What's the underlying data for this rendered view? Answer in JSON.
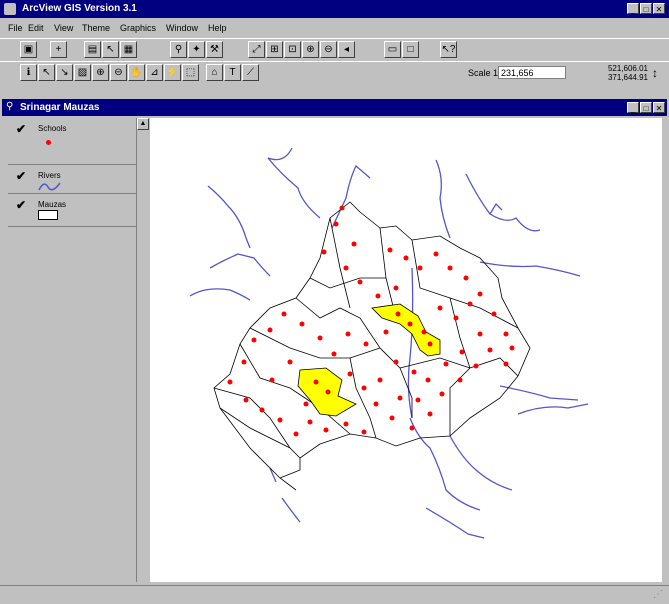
{
  "app": {
    "title": "ArcView GIS Version 3.1"
  },
  "menu": [
    "File",
    "Edit",
    "View",
    "Theme",
    "Graphics",
    "Window",
    "Help"
  ],
  "scale": {
    "label": "Scale 1:",
    "value": "231,656"
  },
  "coords": {
    "x": "521,606.01",
    "y": "371,644.91"
  },
  "document": {
    "title": "Srinagar Mauzas"
  },
  "themes": [
    {
      "name": "Schools"
    },
    {
      "name": "Rivers"
    },
    {
      "name": "Mauzas"
    }
  ],
  "colors": {
    "title_bar": "#000080",
    "highlight": "#ffff00",
    "schools": "#ff0000",
    "rivers": "#5555cc",
    "map_bg": "#ffffff"
  }
}
